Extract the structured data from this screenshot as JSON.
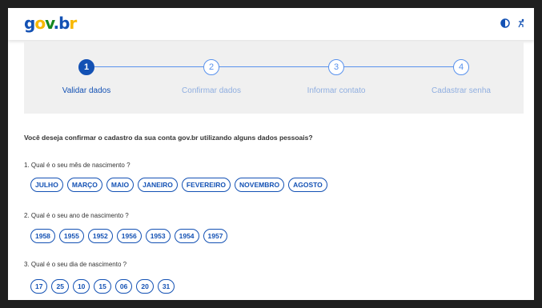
{
  "header": {
    "logo": {
      "g": "g",
      "o": "o",
      "v": "v",
      "dot": ".",
      "b": "b",
      "r": "r"
    },
    "icons": [
      "contrast-icon",
      "accessibility-icon"
    ]
  },
  "steps": [
    {
      "number": "1",
      "label": "Validar dados",
      "active": true
    },
    {
      "number": "2",
      "label": "Confirmar dados",
      "active": false
    },
    {
      "number": "3",
      "label": "Informar contato",
      "active": false
    },
    {
      "number": "4",
      "label": "Cadastrar senha",
      "active": false
    }
  ],
  "main_question": "Você deseja confirmar o cadastro da sua conta gov.br utilizando alguns dados pessoais?",
  "questions": [
    {
      "label": "1. Qual é o seu mês de nascimento ?",
      "options": [
        "JULHO",
        "MARÇO",
        "MAIO",
        "JANEIRO",
        "FEVEREIRO",
        "NOVEMBRO",
        "AGOSTO"
      ]
    },
    {
      "label": "2. Qual é o seu ano de nascimento ?",
      "options": [
        "1958",
        "1955",
        "1952",
        "1956",
        "1953",
        "1954",
        "1957"
      ]
    },
    {
      "label": "3. Qual é o seu dia de nascimento ?",
      "options": [
        "17",
        "25",
        "10",
        "15",
        "06",
        "20",
        "31"
      ]
    }
  ],
  "colors": {
    "primary": "#1351b4",
    "inactive": "#5992ed",
    "panel": "#f0f0f0"
  }
}
